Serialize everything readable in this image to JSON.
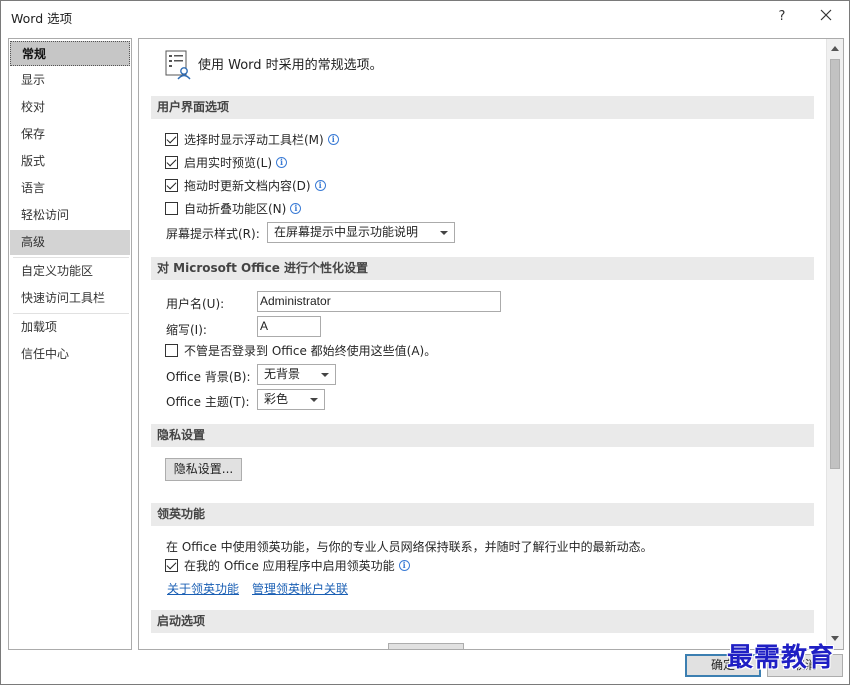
{
  "window": {
    "title": "Word 选项",
    "help_glyph": "?"
  },
  "sidebar": {
    "items": [
      {
        "label": "常规"
      },
      {
        "label": "显示"
      },
      {
        "label": "校对"
      },
      {
        "label": "保存"
      },
      {
        "label": "版式"
      },
      {
        "label": "语言"
      },
      {
        "label": "轻松访问"
      },
      {
        "label": "高级"
      },
      {
        "label": "自定义功能区"
      },
      {
        "label": "快速访问工具栏"
      },
      {
        "label": "加载项"
      },
      {
        "label": "信任中心"
      }
    ]
  },
  "main": {
    "header_text": "使用 Word 时采用的常规选项。",
    "ui_section": {
      "title": "用户界面选项",
      "options": [
        {
          "label": "选择时显示浮动工具栏(M)",
          "checked": true
        },
        {
          "label": "启用实时预览(L)",
          "checked": true
        },
        {
          "label": "拖动时更新文档内容(D)",
          "checked": true
        },
        {
          "label": "自动折叠功能区(N)",
          "checked": false
        }
      ],
      "screentip_label": "屏幕提示样式(R):",
      "screentip_value": "在屏幕提示中显示功能说明"
    },
    "personalize_section": {
      "title": "对 Microsoft Office 进行个性化设置",
      "username_label": "用户名(U):",
      "username_value": "Administrator",
      "initials_label": "缩写(I):",
      "initials_value": "A",
      "always_use_label": "不管是否登录到 Office 都始终使用这些值(A)。",
      "always_use_checked": false,
      "background_label": "Office 背景(B):",
      "background_value": "无背景",
      "theme_label": "Office 主题(T):",
      "theme_value": "彩色"
    },
    "privacy_section": {
      "title": "隐私设置",
      "button_label": "隐私设置..."
    },
    "linkedin_section": {
      "title": "领英功能",
      "description": "在 Office 中使用领英功能，与你的专业人员网络保持联系，并随时了解行业中的最新动态。",
      "enable_label": "在我的 Office 应用程序中启用领英功能",
      "enable_checked": true,
      "about_link": "关于领英功能",
      "manage_link": "管理领英帐户关联"
    },
    "startup_section": {
      "title": "启动选项"
    }
  },
  "footer": {
    "ok_label": "确定",
    "cancel_label": "取消"
  },
  "watermark": "最需教育",
  "colors": {
    "link": "#1a5fb4",
    "info_icon": "#3a7bd5",
    "selected_nav": "#c6c6c6",
    "section_bg": "#eaeaea",
    "watermark": "#1f1fc4"
  }
}
